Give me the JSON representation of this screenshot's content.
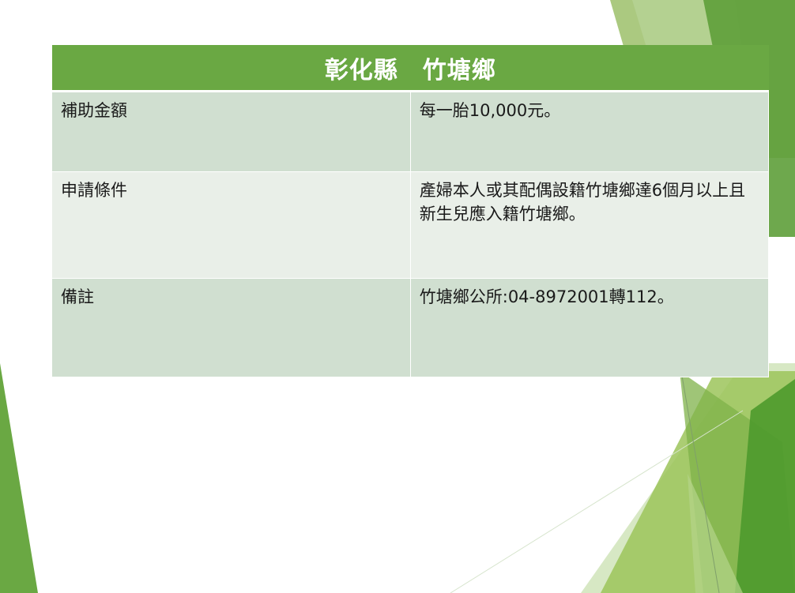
{
  "table": {
    "title": "彰化縣　竹塘鄉",
    "rows": [
      {
        "label": "補助金額",
        "value": "每一胎10,000元。"
      },
      {
        "label": "申請條件",
        "value": "產婦本人或其配偶設籍竹塘鄉達6個月以上且新生兒應入籍竹塘鄉。"
      },
      {
        "label": "備註",
        "value": "竹塘鄉公所:04-8972001轉112。"
      }
    ]
  },
  "colors": {
    "header_bg": "#6aa843",
    "row_dark": "#d0dfd0",
    "row_light": "#e9efe8",
    "accent_green": "#8bc34a"
  }
}
